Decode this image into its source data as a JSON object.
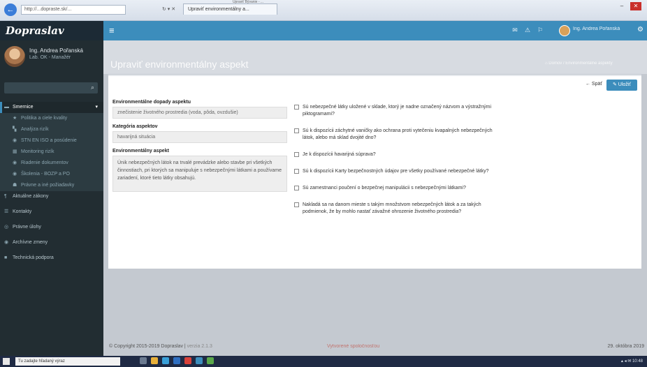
{
  "browser": {
    "window_title": "Upraviť Bývanie - ... ",
    "address": "http://...dopraste.sk/...",
    "tab_label": "Upraviť environmentálny a...",
    "back": "←",
    "addr_ctrls": "↻ ▾ ✕",
    "minimize": "–",
    "close": "✕"
  },
  "app": {
    "logo": "Dopraslav",
    "menu": "≡",
    "header_icons": [
      "✉",
      "⚠",
      "⚐"
    ],
    "user": "Ing. Andrea Pořanská",
    "gear": "⚙"
  },
  "sidebar": {
    "user_name": "Ing. Andrea Pořanská",
    "user_status": "Lab. OK - Manažér",
    "search_placeholder": "",
    "search_icon": "⌕",
    "items": [
      {
        "label": "Smernice",
        "icon": "▬",
        "active": true
      },
      {
        "label": "Politika a ciele kvality",
        "icon": "★"
      },
      {
        "label": "Analýza rizík",
        "icon": "▚"
      },
      {
        "label": "STN EN ISO a posúdenie",
        "icon": "◉"
      },
      {
        "label": "Monitoring rizík",
        "icon": "▦"
      },
      {
        "label": "Riadenie dokumentov",
        "icon": "◉"
      },
      {
        "label": "Školenia - BOZP a PO",
        "icon": "◉"
      },
      {
        "label": "Právne a iné požiadavky",
        "icon": "☗"
      },
      {
        "label": "Aktuálne zákony",
        "icon": "¶"
      },
      {
        "label": "Kontakty",
        "icon": "☰"
      },
      {
        "label": "Právne úlohy",
        "icon": "◎"
      },
      {
        "label": "Archívne zmeny",
        "icon": "◉"
      },
      {
        "label": "Technická podpora",
        "icon": "■"
      }
    ]
  },
  "page": {
    "title": "Upraviť environmentálny aspekt",
    "breadcrumb": "⌂ Domov / Environmentálne aspekty",
    "back_label": "← Späť",
    "edit_label": "✎ Uložiť"
  },
  "form": {
    "impacts_label": "Environmentálne dopady aspektu",
    "impacts_value": "znečistenie životného prostredia (voda, pôda, ovzdušie)",
    "category_label": "Kategória aspektov",
    "category_value": "havarijná situácia",
    "aspect_label": "Environmentálny aspekt",
    "aspect_value": "Únik nebezpečných látok na trvalé prevádzke alebo stavbe pri všetkých činnostiach, pri ktorých sa manipuluje s nebezpečnými látkami a používame zariadení, ktoré tieto látky obsahujú."
  },
  "questions": [
    "Sú nebezpečné látky uložené v sklade, ktorý je nadne označený názvom a výstražnými piktogramami?",
    "Sú k dispozícii záchytné vaničky ako ochrana proti vytečeniu kvapalných nebezpečných látok, alebo má sklad dvojité dno?",
    "Je k dispozícii havarijná súprava?",
    "Sú k dispozícii Karty bezpečnostných údajov pre všetky používané nebezpečné látky?",
    "Sú zamestnanci poučení o bezpečnej manipulácii s nebezpečnými látkami?",
    "Nakladá sa na danom mieste s takým množstvom nebezpečných látok a za takých podmienok, že by mohlo nastať závažné ohrozenie životného prostredia?"
  ],
  "footer": {
    "copyright": "© Copyright 2015-2019 Dopraslav",
    "version": "verzia 2.1.3",
    "middle": "Vytvorené spoločnosťou",
    "date": "29. októbra 2019"
  },
  "taskbar": {
    "search_placeholder": "Tu zadajte hľadaný výraz",
    "tray": "▴ ◂ ✉ 10:48"
  },
  "colors": {
    "header": "#3c8dbc",
    "sidebar": "#222d32",
    "accent": "#3c8dbc"
  }
}
